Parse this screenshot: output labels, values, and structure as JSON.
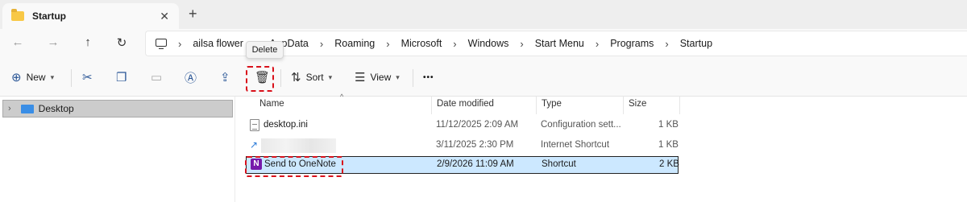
{
  "window": {
    "tab_title": "Startup",
    "tab_close": "✕",
    "new_tab": "+"
  },
  "nav": {
    "back": "←",
    "forward": "→",
    "up": "↑",
    "refresh": "↻"
  },
  "breadcrumb": [
    "ailsa flower",
    "AppData",
    "Roaming",
    "Microsoft",
    "Windows",
    "Start Menu",
    "Programs",
    "Startup"
  ],
  "tooltip": "Delete",
  "toolbar": {
    "new_label": "New",
    "sort_label": "Sort",
    "view_label": "View",
    "more_label": "•••"
  },
  "navpane": {
    "items": [
      {
        "label": "Desktop"
      }
    ]
  },
  "filelist": {
    "columns": [
      "Name",
      "Date modified",
      "Type",
      "Size"
    ],
    "rows": [
      {
        "name": "desktop.ini",
        "date": "11/12/2025 2:09 AM",
        "type": "Configuration sett...",
        "size": "1 KB",
        "icon": "ini-file-icon"
      },
      {
        "name": "",
        "date": "3/11/2025 2:30 PM",
        "type": "Internet Shortcut",
        "size": "1 KB",
        "icon": "internet-shortcut-icon"
      },
      {
        "name": "Send to OneNote",
        "date": "2/9/2026 11:09 AM",
        "type": "Shortcut",
        "size": "2 KB",
        "icon": "onenote-icon",
        "selected": true
      }
    ]
  },
  "colors": {
    "highlight": "#d9111b",
    "selection": "#cce8ff",
    "accent": "#2b5797"
  }
}
